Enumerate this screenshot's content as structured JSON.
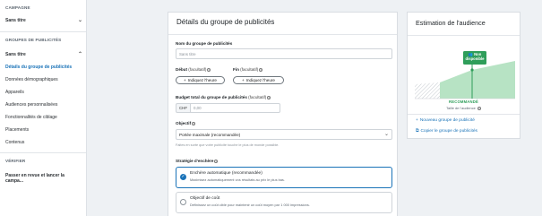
{
  "sidebar": {
    "campaign_section": "CAMPAGNE",
    "campaign_item": "Sans titre",
    "adgroups_section": "GROUPES DE PUBLICITÉS",
    "adgroup_item": "Sans titre",
    "sub_items": [
      {
        "label": "Détails du groupe de publicités",
        "active": true
      },
      {
        "label": "Données démographiques",
        "active": false
      },
      {
        "label": "Appareils",
        "active": false
      },
      {
        "label": "Audiences personnalisées",
        "active": false
      },
      {
        "label": "Fonctionnalités de ciblage",
        "active": false
      },
      {
        "label": "Placements",
        "active": false
      },
      {
        "label": "Contenus",
        "active": false
      }
    ],
    "verify_section": "VÉRIFIER",
    "verify_item": "Passer en revue et lancer la campa..."
  },
  "details": {
    "title": "Détails du groupe de publicités",
    "name_label": "Nom du groupe de publicités",
    "name_placeholder": "Sans titre",
    "start_label": "Début",
    "end_label": "Fin",
    "optional": "(facultatif)",
    "time_button": "Indiquez l'heure",
    "budget_label": "Budget total du groupe de publicités",
    "currency": "CHF",
    "budget_placeholder": "0,00",
    "objective_label": "Objectif",
    "objective_value": "Portée maximale (recommandée)",
    "objective_hint": "Faites en sorte que votre publicité touche le plus de monde possible.",
    "bid_label": "Stratégie d'enchère",
    "bid_options": [
      {
        "title": "Enchère automatique (recommandée)",
        "desc": "Maximisez automatiquement vos résultats au prix le plus bas.",
        "selected": true
      },
      {
        "title": "Objectif de coût",
        "desc": "Définissez un coût cible pour maintenir un coût moyen par 1 000 impressions.",
        "selected": false
      }
    ]
  },
  "estimate": {
    "title": "Estimation de l'audience",
    "badge_line1": "Non",
    "badge_line2": "disponible",
    "recommended": "RECOMMANDÉ",
    "audience_size": "Taille de l'audience",
    "links": [
      {
        "icon": "plus-icon",
        "label": "Nouveau groupe de publicité"
      },
      {
        "icon": "copy-icon",
        "label": "Copier le groupe de publicités"
      }
    ]
  },
  "colors": {
    "accent": "#1a73b8",
    "green": "#2f9e5a",
    "green_light": "#b7e3c4"
  }
}
